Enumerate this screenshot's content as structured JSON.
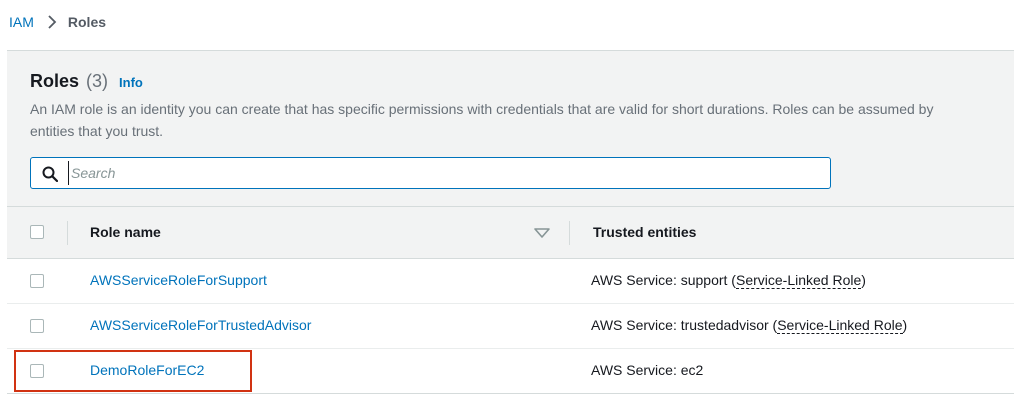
{
  "breadcrumb": {
    "root": "IAM",
    "separator_icon": "chevron-right-icon",
    "current": "Roles"
  },
  "header": {
    "title": "Roles",
    "count": "(3)",
    "info_link": "Info",
    "description": "An IAM role is an identity you can create that has specific permissions with credentials that are valid for short durations. Roles can be assumed by entities that you trust."
  },
  "search": {
    "icon": "search-icon",
    "placeholder": "Search",
    "value": ""
  },
  "table": {
    "columns": {
      "role_name": "Role name",
      "trusted_entities": "Trusted entities"
    },
    "rows": [
      {
        "role_name": "AWSServiceRoleForSupport",
        "trusted_prefix": "AWS Service: support (",
        "trusted_link": "Service-Linked Role",
        "trusted_suffix": ")"
      },
      {
        "role_name": "AWSServiceRoleForTrustedAdvisor",
        "trusted_prefix": "AWS Service: trustedadvisor (",
        "trusted_link": "Service-Linked Role",
        "trusted_suffix": ")"
      },
      {
        "role_name": "DemoRoleForEC2",
        "trusted_prefix": "AWS Service: ec2",
        "trusted_link": "",
        "trusted_suffix": ""
      }
    ]
  },
  "colors": {
    "link": "#0073bb",
    "header_bg": "#f2f3f3",
    "highlight": "#d13212"
  }
}
